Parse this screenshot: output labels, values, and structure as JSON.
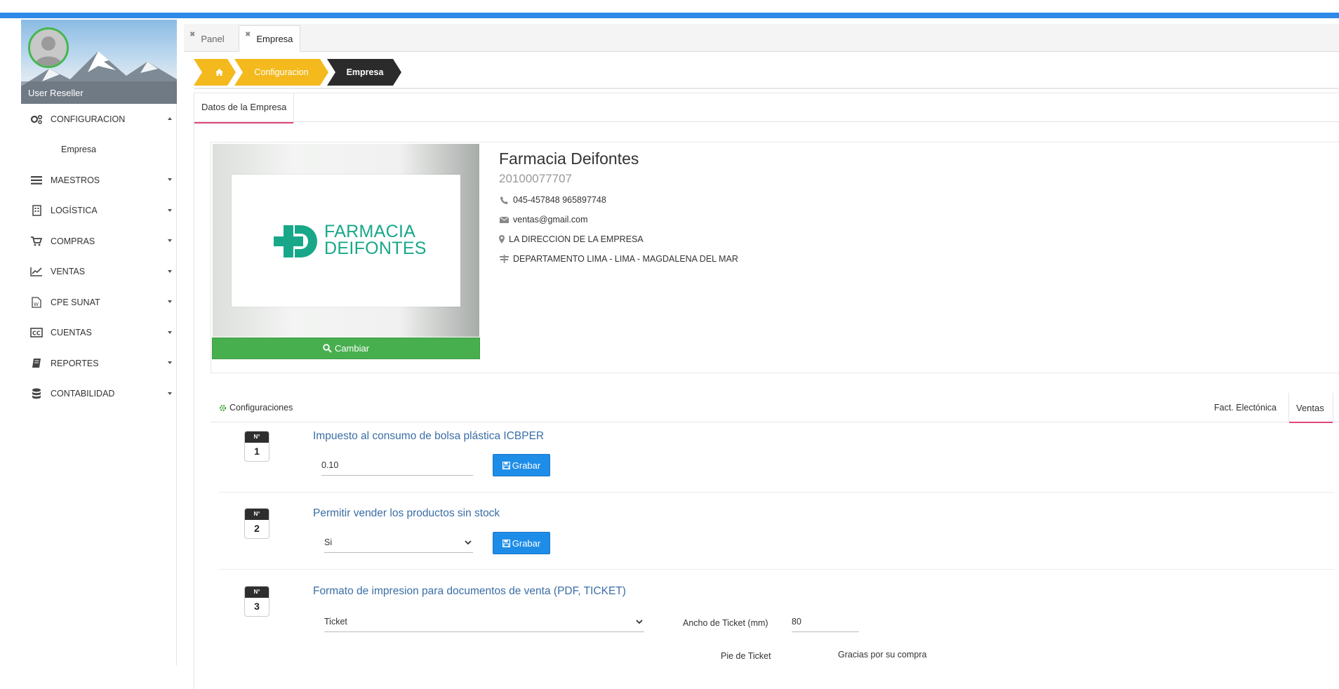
{
  "sidebar": {
    "user_name": "User Reseller",
    "items": [
      {
        "label": "CONFIGURACION",
        "icon": "gears-icon"
      },
      {
        "label": "Empresa",
        "icon": ""
      },
      {
        "label": "MAESTROS",
        "icon": "list-icon"
      },
      {
        "label": "LOGÍSTICA",
        "icon": "building-icon"
      },
      {
        "label": "COMPRAS",
        "icon": "cart-icon"
      },
      {
        "label": "VENTAS",
        "icon": "line-chart-icon"
      },
      {
        "label": "CPE SUNAT",
        "icon": "word-file-icon"
      },
      {
        "label": "CUENTAS",
        "icon": "cc-icon"
      },
      {
        "label": "REPORTES",
        "icon": "book-icon"
      },
      {
        "label": "CONTABILIDAD",
        "icon": "database-icon"
      }
    ]
  },
  "tabs": [
    {
      "label": "Panel"
    },
    {
      "label": "Empresa"
    }
  ],
  "breadcrumb": {
    "home_icon": "home-icon",
    "items": [
      "Configuracion",
      "Empresa"
    ]
  },
  "panel_tab": "Datos de la Empresa",
  "company": {
    "logo_line1": "FARMACIA",
    "logo_line2": "DEIFONTES",
    "change_button": "Cambiar",
    "name": "Farmacia Deifontes",
    "ruc": "20100077707",
    "phone": "045-457848 965897748",
    "email": "ventas@gmail.com",
    "address": "LA DIRECCION DE LA EMPRESA",
    "location": "DEPARTAMENTO LIMA - LIMA - MAGDALENA DEL MAR"
  },
  "config": {
    "title": "Configuraciones",
    "tabs": [
      "Fact. Electónica",
      "Ventas"
    ],
    "badge_label": "N°",
    "rows": [
      {
        "num": "1",
        "title": "Impuesto al consumo de bolsa plástica ICBPER",
        "value": "0.10",
        "button": "Grabar"
      },
      {
        "num": "2",
        "title": "Permitir vender los productos sin stock",
        "value": "Si",
        "button": "Grabar"
      },
      {
        "num": "3",
        "title": "Formato de impresion para documentos de venta (PDF, TICKET)",
        "value": "Ticket",
        "ticket_width_label": "Ancho de Ticket (mm)",
        "ticket_width_value": "80",
        "footer_label": "Pie de Ticket",
        "footer_value": "Gracias por su compra"
      }
    ]
  },
  "colors": {
    "accent_yellow": "#f3b91d",
    "accent_dark": "#2b2b2b",
    "green": "#48af4f",
    "blue": "#1e8de8",
    "pink": "#e0457b",
    "logo_green": "#18a889"
  }
}
